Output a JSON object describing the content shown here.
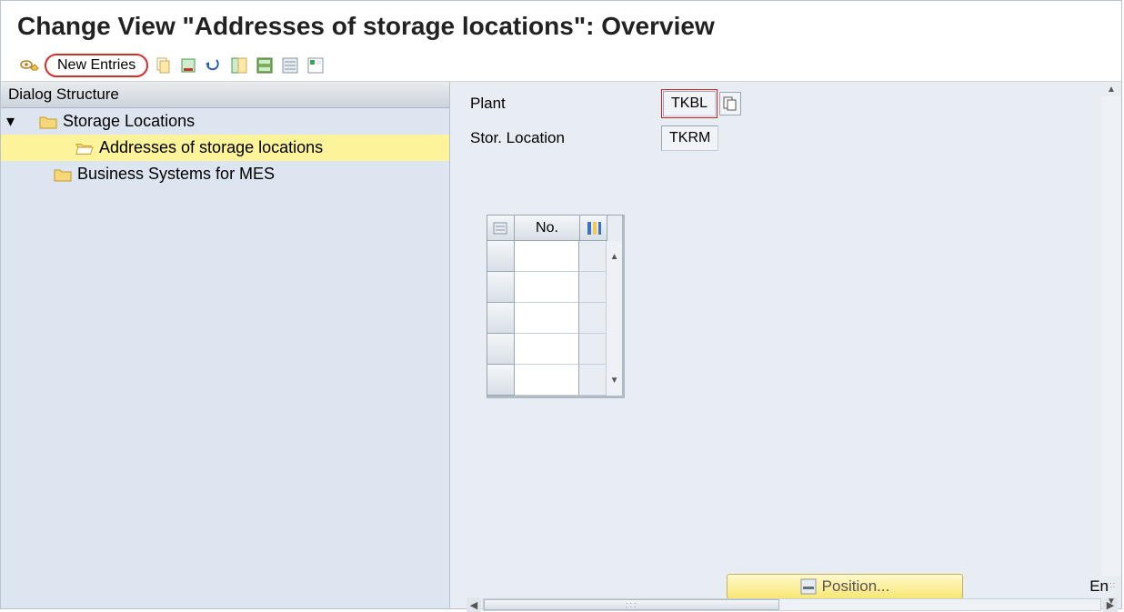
{
  "title": "Change View \"Addresses of storage locations\": Overview",
  "toolbar": {
    "new_entries_label": "New Entries"
  },
  "left_panel": {
    "header": "Dialog Structure",
    "tree": {
      "root": {
        "label": "Storage Locations"
      },
      "child1": {
        "label": "Addresses of storage locations",
        "selected": true
      },
      "child2": {
        "label": "Business Systems for MES"
      }
    }
  },
  "right_panel": {
    "fields": {
      "plant": {
        "label": "Plant",
        "value": "TKBL"
      },
      "stor_location": {
        "label": "Stor. Location",
        "value": "TKRM"
      }
    },
    "grid": {
      "col_no": "No.",
      "rows": [
        "",
        "",
        "",
        "",
        ""
      ]
    },
    "position_button": "Position...",
    "entry_text": "En"
  }
}
